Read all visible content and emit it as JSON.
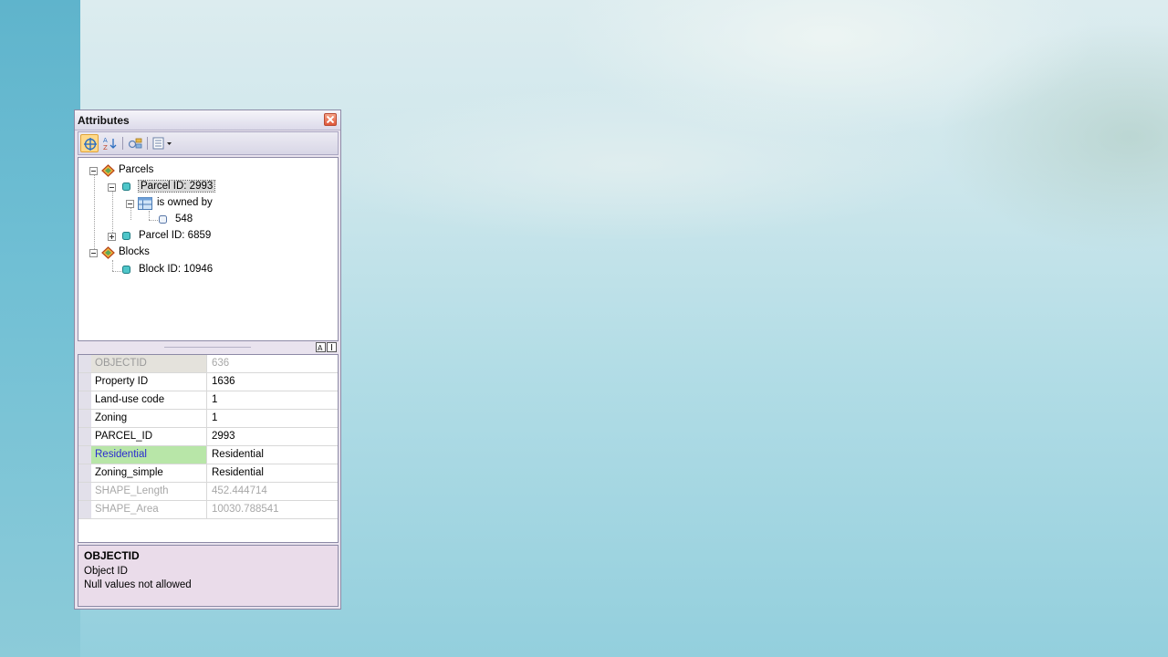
{
  "window": {
    "title": "Attributes"
  },
  "toolbar": {
    "buttons": [
      {
        "icon": "identify-features-icon",
        "active": true
      },
      {
        "icon": "sort-ascending-icon"
      },
      {
        "icon": "find-related-icon"
      },
      {
        "icon": "options-list-icon"
      }
    ]
  },
  "tree": {
    "parcels_label": "Parcels",
    "parcel_2993_label": "Parcel ID: 2993",
    "is_owned_by_label": "is owned by",
    "owner_548_label": "548",
    "parcel_6859_label": "Parcel ID: 6859",
    "blocks_label": "Blocks",
    "block_10946_label": "Block ID: 10946"
  },
  "grid": {
    "rows": [
      {
        "name": "OBJECTID",
        "value": "636"
      },
      {
        "name": "Property ID",
        "value": "1636"
      },
      {
        "name": "Land-use code",
        "value": "1"
      },
      {
        "name": "Zoning",
        "value": "1"
      },
      {
        "name": "PARCEL_ID",
        "value": "2993"
      },
      {
        "name": "Residential",
        "value": "Residential"
      },
      {
        "name": "Zoning_simple",
        "value": "Residential"
      },
      {
        "name": "SHAPE_Length",
        "value": "452.444714"
      },
      {
        "name": "SHAPE_Area",
        "value": "10030.788541"
      }
    ]
  },
  "description": {
    "title": "OBJECTID",
    "line1": "Object ID",
    "line2": "Null values not allowed"
  },
  "colors": {
    "highlight_field_bg": "#b8e6a8",
    "highlight_field_text": "#2a2ad0",
    "active_tool_bg": "#ffd989"
  }
}
